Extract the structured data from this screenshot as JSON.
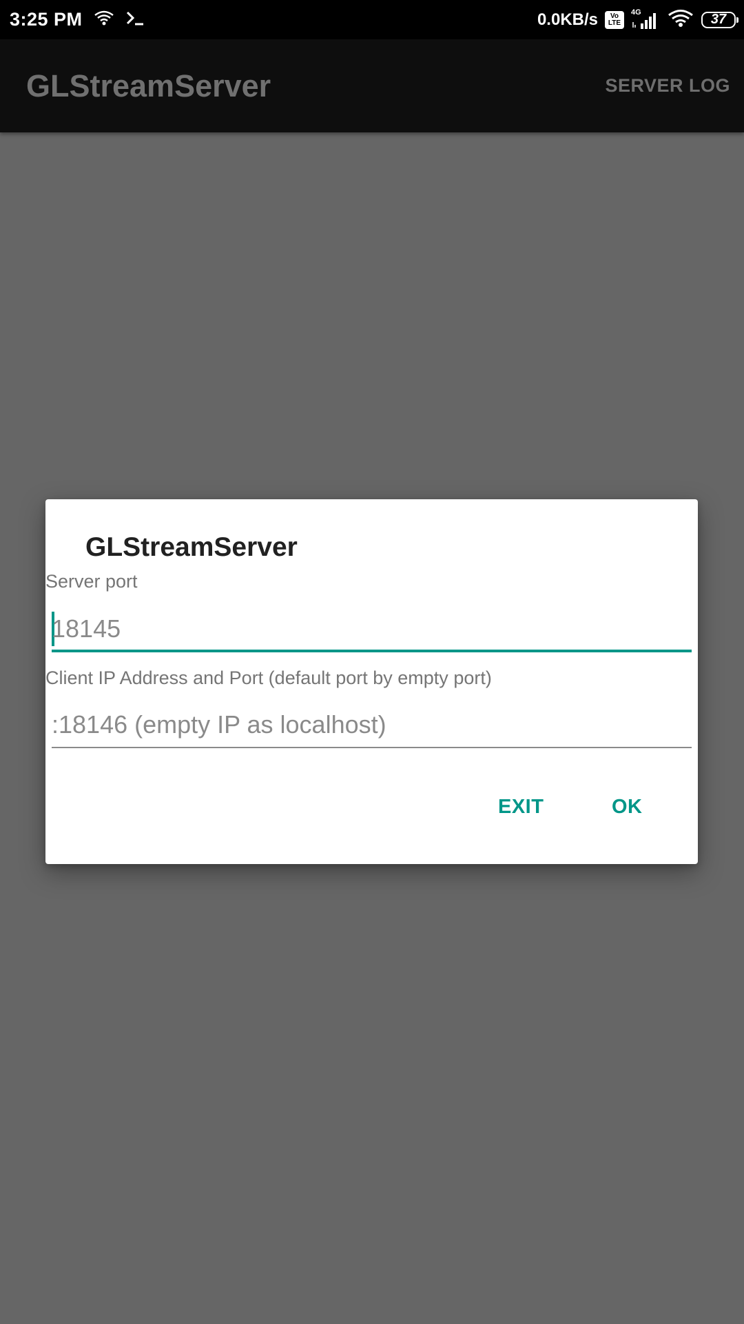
{
  "status_bar": {
    "time": "3:25 PM",
    "net_speed": "0.0KB/s",
    "volte_top": "Vo",
    "volte_bottom": "LTE",
    "network_type": "4G",
    "battery": "37",
    "icons": [
      "wifi-icon",
      "terminal-icon",
      "volte-icon",
      "signal-icon",
      "wifi-icon",
      "battery-icon"
    ]
  },
  "app_bar": {
    "title": "GLStreamServer",
    "action_label": "SERVER LOG"
  },
  "dialog": {
    "title": "GLStreamServer",
    "server_port": {
      "label": "Server port",
      "value": "18145"
    },
    "client": {
      "label": "Client IP Address and Port (default port by empty port)",
      "value": ":18146 (empty IP as localhost)"
    },
    "buttons": {
      "exit": "EXIT",
      "ok": "OK"
    }
  },
  "colors": {
    "accent": "#009688",
    "scrim": "#666666",
    "app_bar": "#0e0e0e",
    "status_bar": "#000000"
  }
}
